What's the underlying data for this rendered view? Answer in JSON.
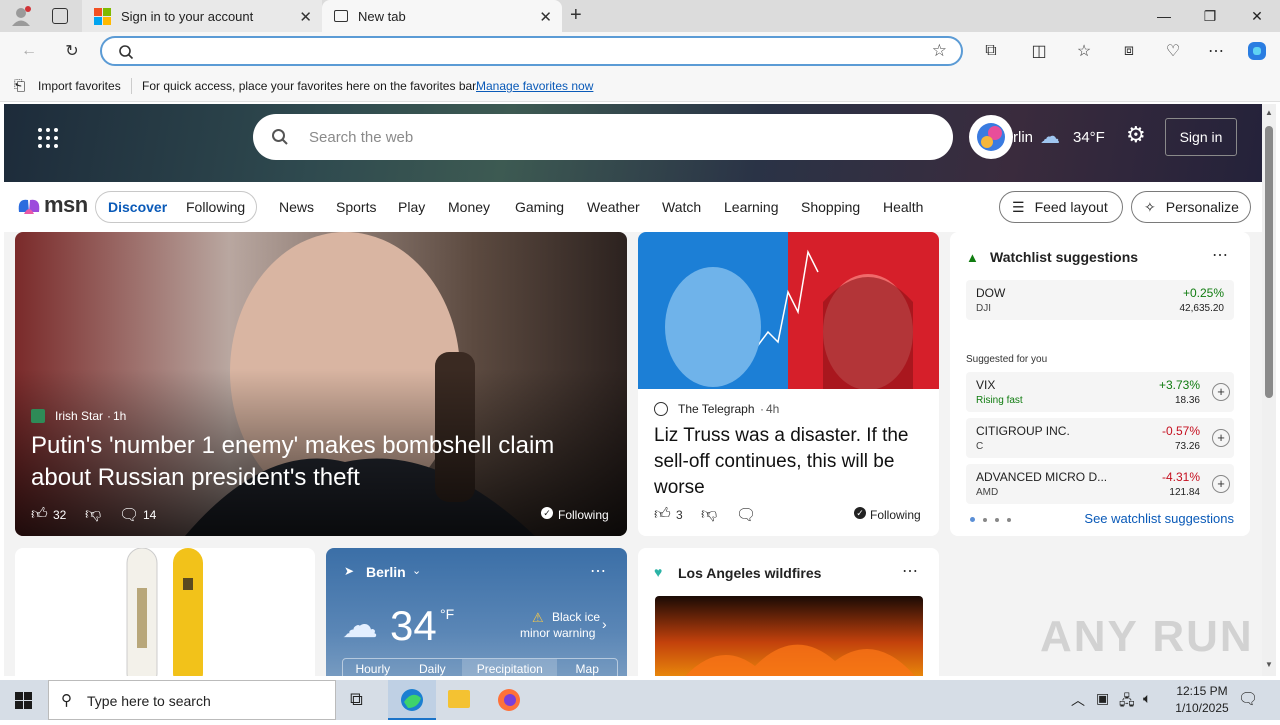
{
  "browser": {
    "tabs": [
      {
        "title": "Sign in to your account"
      },
      {
        "title": "New tab"
      }
    ],
    "favorites_bar": {
      "import_label": "Import favorites",
      "message": "For quick access, place your favorites here on the favorites bar.",
      "manage_link": "Manage favorites now"
    },
    "address": {
      "value": "",
      "placeholder": ""
    }
  },
  "msn": {
    "search_placeholder": "Search the web",
    "location_partial": "rlin",
    "weather_temp": "34°F",
    "sign_in": "Sign in",
    "logo": "msn",
    "tabs": [
      "Discover",
      "Following"
    ],
    "nav": [
      "News",
      "Sports",
      "Play",
      "Money",
      "Gaming",
      "Weather",
      "Watch",
      "Learning",
      "Shopping",
      "Health"
    ],
    "feed_layout": "Feed layout",
    "personalize": "Personalize"
  },
  "main_story": {
    "source": "Irish Star",
    "age": "1h",
    "headline": "Putin's 'number 1 enemy' makes bombshell claim about Russian president's theft",
    "likes": "32",
    "comments": "14",
    "following": "Following"
  },
  "second_story": {
    "source": "The Telegraph",
    "age": "4h",
    "headline": "Liz Truss was a disaster. If the sell-off continues, this will be worse",
    "likes": "3",
    "following": "Following"
  },
  "watchlist": {
    "title": "Watchlist suggestions",
    "index": {
      "name": "DOW",
      "sub": "DJI",
      "change": "+0.25%",
      "value": "42,635.20"
    },
    "suggested_label": "Suggested for you",
    "items": [
      {
        "name": "VIX",
        "sub": "Rising fast",
        "change": "+3.73%",
        "value": "18.36",
        "color": "#107c10"
      },
      {
        "name": "CITIGROUP INC.",
        "sub": "C",
        "change": "-0.57%",
        "value": "73.26",
        "color": "#c50f1f"
      },
      {
        "name": "ADVANCED MICRO D...",
        "sub": "AMD",
        "change": "-4.31%",
        "value": "121.84",
        "color": "#c50f1f"
      }
    ],
    "see_more": "See watchlist suggestions"
  },
  "weather_card": {
    "city": "Berlin",
    "temp": "34",
    "unit": "°F",
    "alert_line1": "Black ice",
    "alert_line2": "minor warning",
    "tabs": [
      "Hourly",
      "Daily",
      "Precipitation",
      "Map"
    ]
  },
  "wildfires_card": {
    "title": "Los Angeles wildfires"
  },
  "taskbar": {
    "search_placeholder": "Type here to search",
    "time": "12:15 PM",
    "date": "1/10/2025"
  },
  "watermark": "ANY RUN"
}
